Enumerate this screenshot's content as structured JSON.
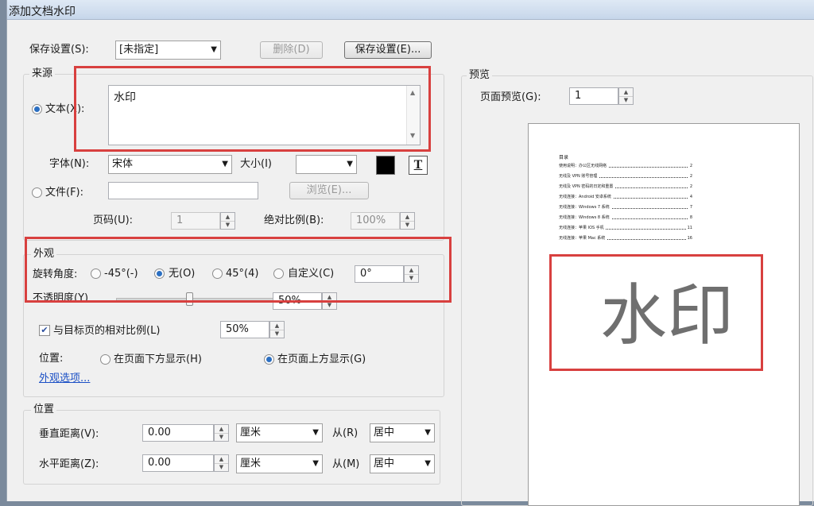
{
  "window": {
    "title": "添加文档水印"
  },
  "top": {
    "save_settings_label": "保存设置(S):",
    "save_settings_value": "[未指定]",
    "delete_button": "删除(D)",
    "save_button": "保存设置(E)..."
  },
  "source": {
    "group_title": "来源",
    "text_radio_label": "文本(X):",
    "text_value": "水印",
    "font_label": "字体(N):",
    "font_value": "宋体",
    "size_label": "大小(I)",
    "size_value": "",
    "color_swatch": "#000000",
    "format_icon_text": "T",
    "file_radio_label": "文件(F):",
    "file_value": "",
    "browse_button": "浏览(E)...",
    "page_label": "页码(U):",
    "page_value": "1",
    "abs_scale_label": "绝对比例(B):",
    "abs_scale_value": "100%"
  },
  "appearance": {
    "group_title": "外观",
    "rotation_label": "旋转角度:",
    "rot_neg45": "-45°(-)",
    "rot_none": "无(O)",
    "rot_45": "45°(4)",
    "rot_custom": "自定义(C)",
    "rotation_value": "0°",
    "opacity_label": "不透明度(Y)",
    "opacity_value": "50%",
    "relative_scale_label": "与目标页的相对比例(L)",
    "relative_scale_value": "50%",
    "position_label": "位置:",
    "behind_page": "在页面下方显示(H)",
    "on_top": "在页面上方显示(G)",
    "options_link": "外观选项..."
  },
  "position": {
    "group_title": "位置",
    "vertical_label": "垂直距离(V):",
    "vertical_value": "0.00",
    "vertical_unit": "厘米",
    "from_r_label": "从(R)",
    "vertical_from": "居中",
    "horizontal_label": "水平距离(Z):",
    "horizontal_value": "0.00",
    "horizontal_unit": "厘米",
    "from_m_label": "从(M)",
    "horizontal_from": "居中"
  },
  "preview": {
    "group_title": "预览",
    "page_preview_label": "页面预览(G):",
    "page_preview_value": "1",
    "watermark_text": "水印",
    "toc_title": "目录",
    "toc": [
      {
        "text": "使用说明：办公区无线网络",
        "page": "2"
      },
      {
        "text": "无线及 VPN 账号管理",
        "page": "2"
      },
      {
        "text": "无线及 VPN 密码的日定和重置",
        "page": "2"
      },
      {
        "text": "无线连接：Android 安卓系统",
        "page": "4"
      },
      {
        "text": "无线连接：Windows 7 系统",
        "page": "7"
      },
      {
        "text": "无线连接：Windows 8 系统",
        "page": "8"
      },
      {
        "text": "无线连接：苹果 IOS 手机",
        "page": "11"
      },
      {
        "text": "无线连接：苹果 Mac 系统",
        "page": "16"
      }
    ]
  },
  "colors": {
    "highlight": "#d8403f",
    "link": "#1a4fc5",
    "accent": "#2b6fc2"
  }
}
